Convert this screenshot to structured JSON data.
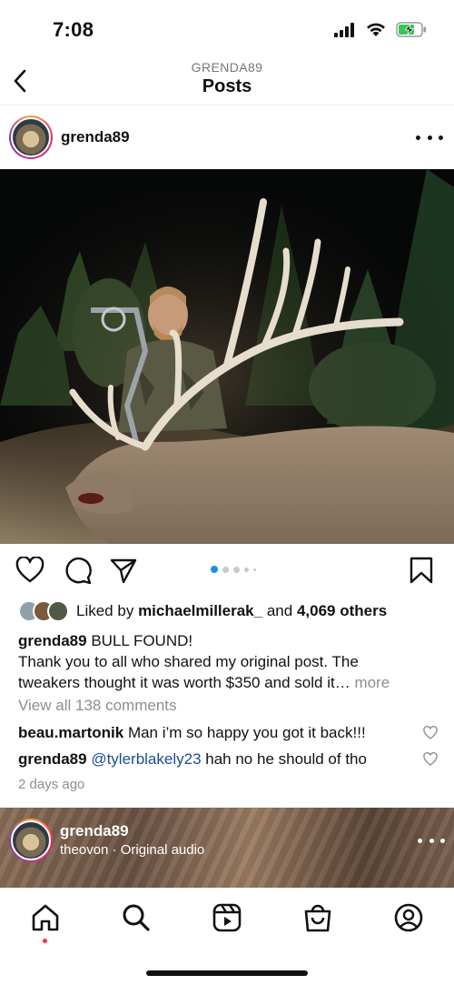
{
  "status_bar": {
    "time": "7:08"
  },
  "nav": {
    "subtitle": "GRENDA89",
    "title": "Posts"
  },
  "post": {
    "username": "grenda89",
    "carousel": {
      "count": 5,
      "active_index": 0
    },
    "likes": {
      "prefix": "Liked by",
      "liked_by": "michaelmillerak_",
      "joiner": "and",
      "others": "4,069 others"
    },
    "caption": {
      "username": "grenda89",
      "line1": "BULL FOUND!",
      "line2": "Thank you to all who shared my original post. The",
      "line3": "tweakers thought it was worth $350 and sold it…",
      "more": "more"
    },
    "view_comments": "View all 138 comments",
    "comments": [
      {
        "user": "beau.martonik",
        "mention": "",
        "text": "Man i’m so happy you got it back!!!"
      },
      {
        "user": "grenda89",
        "mention": "@tylerblakely23",
        "text": "hah no he should of tho"
      }
    ],
    "timestamp": "2 days ago"
  },
  "next_post": {
    "username": "grenda89",
    "audio": "theovon · Original audio"
  },
  "icons": {
    "back": "chevron-left-icon",
    "more": "more-horizontal-icon",
    "like": "heart-icon",
    "comment": "comment-icon",
    "share": "send-icon",
    "save": "bookmark-icon",
    "tabs": [
      "home-icon",
      "search-icon",
      "reels-icon",
      "shop-icon",
      "profile-icon"
    ]
  },
  "colors": {
    "accent_blue": "#1c8ef0",
    "notification_red": "#ff2a4a",
    "mention_blue": "#1d4b8f",
    "battery_green": "#34c759"
  }
}
